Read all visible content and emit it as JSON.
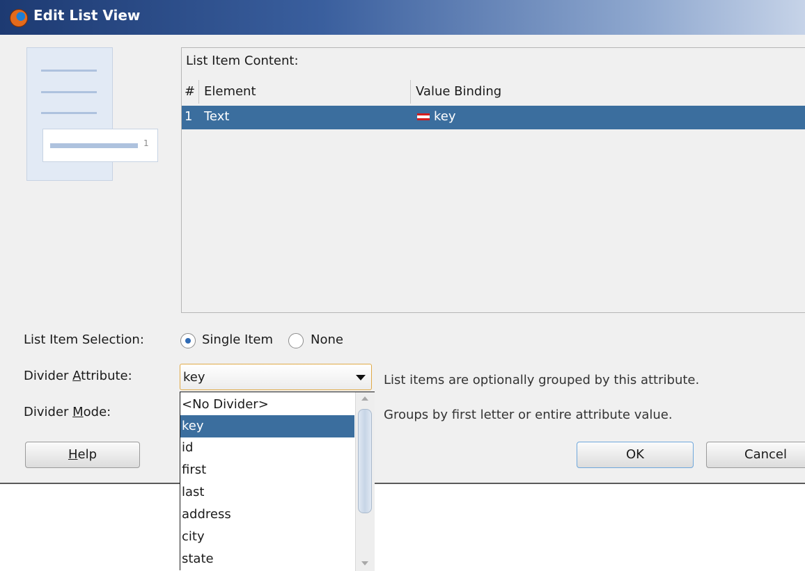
{
  "window": {
    "title": "Edit List View",
    "icon": "jdeveloper-app-icon"
  },
  "preview": {
    "card_number": "1"
  },
  "content": {
    "label": "List Item Content:",
    "columns": [
      "#",
      "Element",
      "Value Binding"
    ],
    "rows": [
      {
        "num": "1",
        "element": "Text",
        "binding": "key",
        "binding_icon": "attribute-binding-icon",
        "selected": true
      }
    ]
  },
  "selection": {
    "label": "List Item Selection:",
    "options": [
      {
        "label": "Single Item",
        "checked": true
      },
      {
        "label": "None",
        "checked": false
      }
    ]
  },
  "divider_attribute": {
    "label_before": "Divider ",
    "label_mnemonic": "A",
    "label_after": "ttribute:",
    "value": "key",
    "hint": "List items are optionally grouped by this attribute.",
    "options": [
      "<No Divider>",
      "key",
      "id",
      "first",
      "last",
      "address",
      "city",
      "state"
    ],
    "selected_index": 1
  },
  "divider_mode": {
    "label_before": "Divider ",
    "label_mnemonic": "M",
    "label_after": "ode:",
    "hint": "Groups by first letter or entire attribute value."
  },
  "buttons": {
    "help_mnemonic": "H",
    "help_rest": "elp",
    "ok": "OK",
    "cancel": "Cancel"
  },
  "colors": {
    "selection": "#3b6e9e",
    "title_gradient_start": "#1d3a72",
    "focus_border": "#e0a946"
  }
}
